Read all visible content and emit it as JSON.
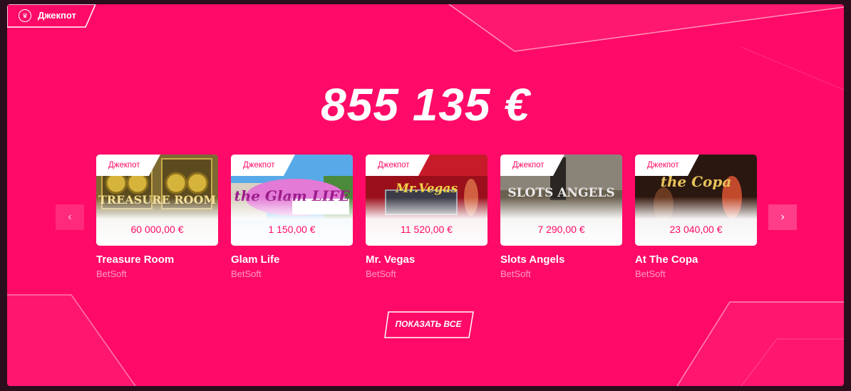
{
  "section": {
    "tag_label": "Джекпот",
    "tag_icon": "crown-icon",
    "jackpot_amount": "855 135 €",
    "show_all_label": "ПОКАЗАТЬ ВСЕ",
    "accent_color": "#ff0a68"
  },
  "games": [
    {
      "badge": "Джекпот",
      "thumb_title": "TREASURE ROOM",
      "amount": "60 000,00 €",
      "name": "Treasure Room",
      "provider": "BetSoft"
    },
    {
      "badge": "Джекпот",
      "thumb_title": "the Glam LIFE",
      "amount": "1 150,00 €",
      "name": "Glam Life",
      "provider": "BetSoft"
    },
    {
      "badge": "Джекпот",
      "thumb_title": "Mr.Vegas",
      "amount": "11 520,00 €",
      "name": "Mr. Vegas",
      "provider": "BetSoft"
    },
    {
      "badge": "Джекпот",
      "thumb_title": "SLOTS ANGELS",
      "amount": "7 290,00 €",
      "name": "Slots Angels",
      "provider": "BetSoft"
    },
    {
      "badge": "Джекпот",
      "thumb_title": "the Copa",
      "amount": "23 040,00 €",
      "name": "At The Copa",
      "provider": "BetSoft"
    }
  ],
  "carousel": {
    "prev_icon": "chevron-left-icon",
    "next_icon": "chevron-right-icon"
  }
}
